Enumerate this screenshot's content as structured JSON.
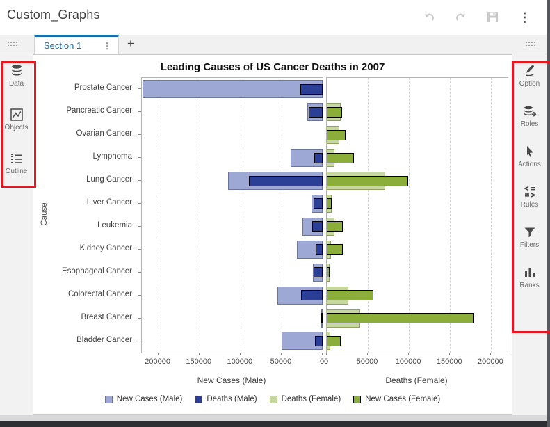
{
  "header": {
    "title": "Custom_Graphs"
  },
  "toolbar": {
    "undo_icon": "undo-arrow",
    "redo_icon": "redo-arrow",
    "save_icon": "floppy-disk",
    "more_icon": "vertical-ellipsis",
    "more_glyph": "⋮"
  },
  "tabbar": {
    "active_tab": "Section 1",
    "tab_menu_glyph": "⋮",
    "add_tab_label": "+"
  },
  "left_rail": {
    "items": [
      {
        "label": "Data",
        "icon": "data-cylinder-icon"
      },
      {
        "label": "Objects",
        "icon": "objects-chart-icon"
      },
      {
        "label": "Outline",
        "icon": "outline-list-icon"
      }
    ]
  },
  "right_rail": {
    "items": [
      {
        "label": "Option",
        "icon": "options-pencil-icon"
      },
      {
        "label": "Roles",
        "icon": "roles-stack-icon"
      },
      {
        "label": "Actions",
        "icon": "actions-cursor-icon"
      },
      {
        "label": "Rules",
        "icon": "rules-compare-icon"
      },
      {
        "label": "Filters",
        "icon": "filters-funnel-icon"
      },
      {
        "label": "Ranks",
        "icon": "ranks-bars-icon"
      }
    ]
  },
  "annotations": {
    "highlight_color": "#e8171f"
  },
  "accent_color": "#1b6fa8",
  "chart_data": {
    "type": "bar",
    "orientation": "horizontal-butterfly",
    "title": "Leading Causes of US Cancer Deaths in 2007",
    "ylabel": "Cause",
    "left_axis_label": "New Cases (Male)",
    "right_axis_label": "Deaths (Female)",
    "axis_max": 220000,
    "ticks": [
      200000,
      150000,
      100000,
      50000,
      0
    ],
    "grid": "vertical-dashed",
    "legend_position": "bottom-center",
    "categories": [
      "Prostate Cancer",
      "Pancreatic Cancer",
      "Ovarian Cancer",
      "Lymphoma",
      "Lung Cancer",
      "Liver Cancer",
      "Leukemia",
      "Kidney Cancer",
      "Esophageal Cancer",
      "Colorectal Cancer",
      "Breast Cancer",
      "Bladder Cancer"
    ],
    "series": [
      {
        "name": "New Cases (Male)",
        "side": "left",
        "layer": "back",
        "color": "#9DA8D4",
        "border": "#6d749c",
        "values": [
          218890,
          18830,
          0,
          38670,
          114760,
          13650,
          24800,
          31590,
          12130,
          55290,
          2030,
          50040
        ]
      },
      {
        "name": "Deaths (Male)",
        "side": "left",
        "layer": "front",
        "color": "#2C3F96",
        "border": "#000000",
        "values": [
          27050,
          16840,
          0,
          10370,
          89510,
          11280,
          12320,
          8080,
          10900,
          26000,
          450,
          9630
        ]
      },
      {
        "name": "Deaths (Female)",
        "side": "right",
        "layer": "back",
        "color": "#C6D7A0",
        "border": "#90a163",
        "values": [
          0,
          16530,
          15280,
          9060,
          70880,
          5500,
          9470,
          4810,
          3040,
          26180,
          40460,
          4120
        ]
      },
      {
        "name": "New Cases (Female)",
        "side": "right",
        "layer": "front",
        "color": "#8BAD3A",
        "border": "#000000",
        "values": [
          0,
          18340,
          22430,
          32710,
          98620,
          5510,
          19440,
          19600,
          3430,
          57050,
          178480,
          17120
        ]
      }
    ]
  }
}
